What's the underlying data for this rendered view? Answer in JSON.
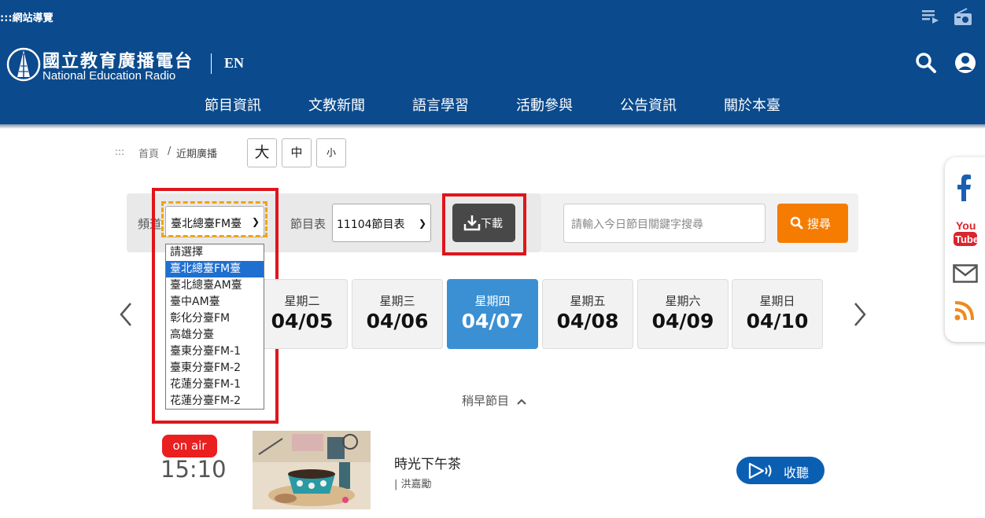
{
  "topbar": {
    "site_nav": ":::網站導覽",
    "icons": [
      "playlist-icon",
      "radio-icon"
    ]
  },
  "header": {
    "logo_cn": "國立教育廣播電台",
    "logo_en": "National Education Radio",
    "lang": "EN",
    "icons": [
      "search-icon",
      "user-icon"
    ],
    "nav": [
      "節目資訊",
      "文教新聞",
      "語言學習",
      "活動參與",
      "公告資訊",
      "關於本臺"
    ]
  },
  "breadcrumb": {
    "dots": ":::",
    "home": "首頁",
    "sep": "/",
    "current": "近期廣播"
  },
  "font_size": {
    "large": "大",
    "medium": "中",
    "small": "小"
  },
  "filter": {
    "channel_label": "頻道",
    "channel_value": "臺北總臺FM臺",
    "schedule_label": "節目表",
    "schedule_value": "11104節目表",
    "download_label": "下載",
    "search_placeholder": "請輸入今日節目關鍵字搜尋",
    "search_button": "搜尋"
  },
  "dropdown": {
    "options": [
      "請選擇",
      "臺北總臺FM臺",
      "臺北總臺AM臺",
      "臺中AM臺",
      "彰化分臺FM",
      "高雄分臺",
      "臺東分臺FM-1",
      "臺東分臺FM-2",
      "花蓮分臺FM-1",
      "花蓮分臺FM-2"
    ],
    "selected_index": 1
  },
  "days": [
    {
      "weekday": "星期二",
      "date": "04/05"
    },
    {
      "weekday": "星期三",
      "date": "04/06"
    },
    {
      "weekday": "星期四",
      "date": "04/07",
      "active": true
    },
    {
      "weekday": "星期五",
      "date": "04/08"
    },
    {
      "weekday": "星期六",
      "date": "04/09"
    },
    {
      "weekday": "星期日",
      "date": "04/10"
    }
  ],
  "earlier_label": "稍早節目",
  "program": {
    "badge": "on air",
    "time": "15:10",
    "title": "時光下午茶",
    "host": "| 洪嘉勵",
    "listen_label": "收聽"
  },
  "social": [
    "facebook-icon",
    "youtube-icon",
    "email-icon",
    "rss-icon"
  ],
  "youtube_text": {
    "you": "You",
    "tube": "Tube"
  },
  "colors": {
    "header_blue": "#0b4a8c",
    "active_day": "#3b90d3",
    "search_orange": "#f57c00",
    "onair_red": "#ea1f1f",
    "highlight_red": "#e0151c",
    "focus_yellow": "#f2a500"
  }
}
